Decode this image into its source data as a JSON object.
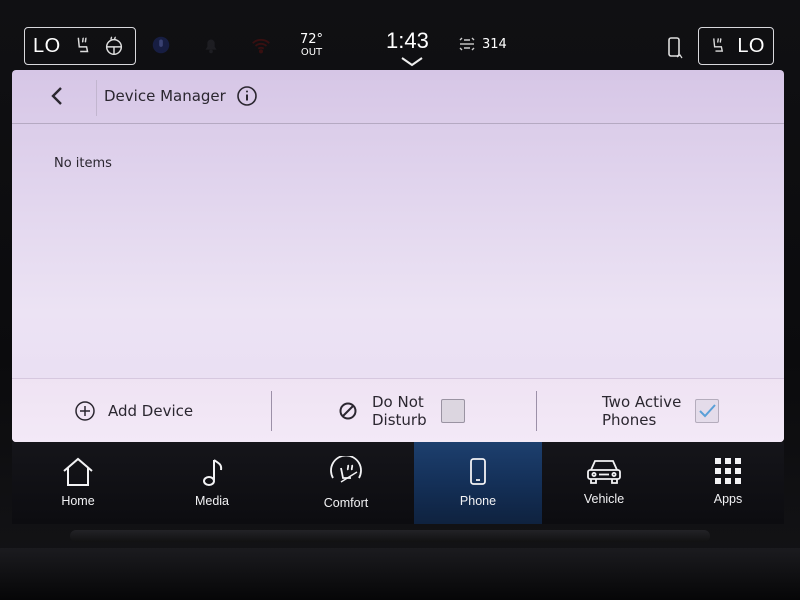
{
  "status_bar": {
    "climate_left": "LO",
    "climate_right": "LO",
    "outside_temp": "72°",
    "outside_label": "OUT",
    "clock": "1:43",
    "range": "314"
  },
  "device_manager": {
    "title": "Device Manager",
    "empty_message": "No items"
  },
  "actions": {
    "add_device": "Add Device",
    "do_not_disturb_line1": "Do Not",
    "do_not_disturb_line2": "Disturb",
    "do_not_disturb_checked": false,
    "two_active_line1": "Two Active",
    "two_active_line2": "Phones",
    "two_active_checked": true
  },
  "nav": {
    "home": "Home",
    "media": "Media",
    "comfort": "Comfort",
    "phone": "Phone",
    "vehicle": "Vehicle",
    "apps": "Apps",
    "active": "Phone"
  },
  "colors": {
    "panel_bg": "#e2d6ee",
    "nav_active": "#1d3f6e",
    "check_accent": "#5aa0d8"
  },
  "icons": [
    "back-chevron-icon",
    "info-icon",
    "add-circle-icon",
    "do-not-disturb-icon",
    "checkmark-icon",
    "home-icon",
    "music-note-icon",
    "comfort-icon",
    "phone-icon",
    "car-icon",
    "apps-grid-icon",
    "seat-heat-icon",
    "microphone-icon",
    "bell-icon",
    "wifi-icon",
    "chevron-down-icon",
    "range-icon",
    "phone-status-icon"
  ]
}
